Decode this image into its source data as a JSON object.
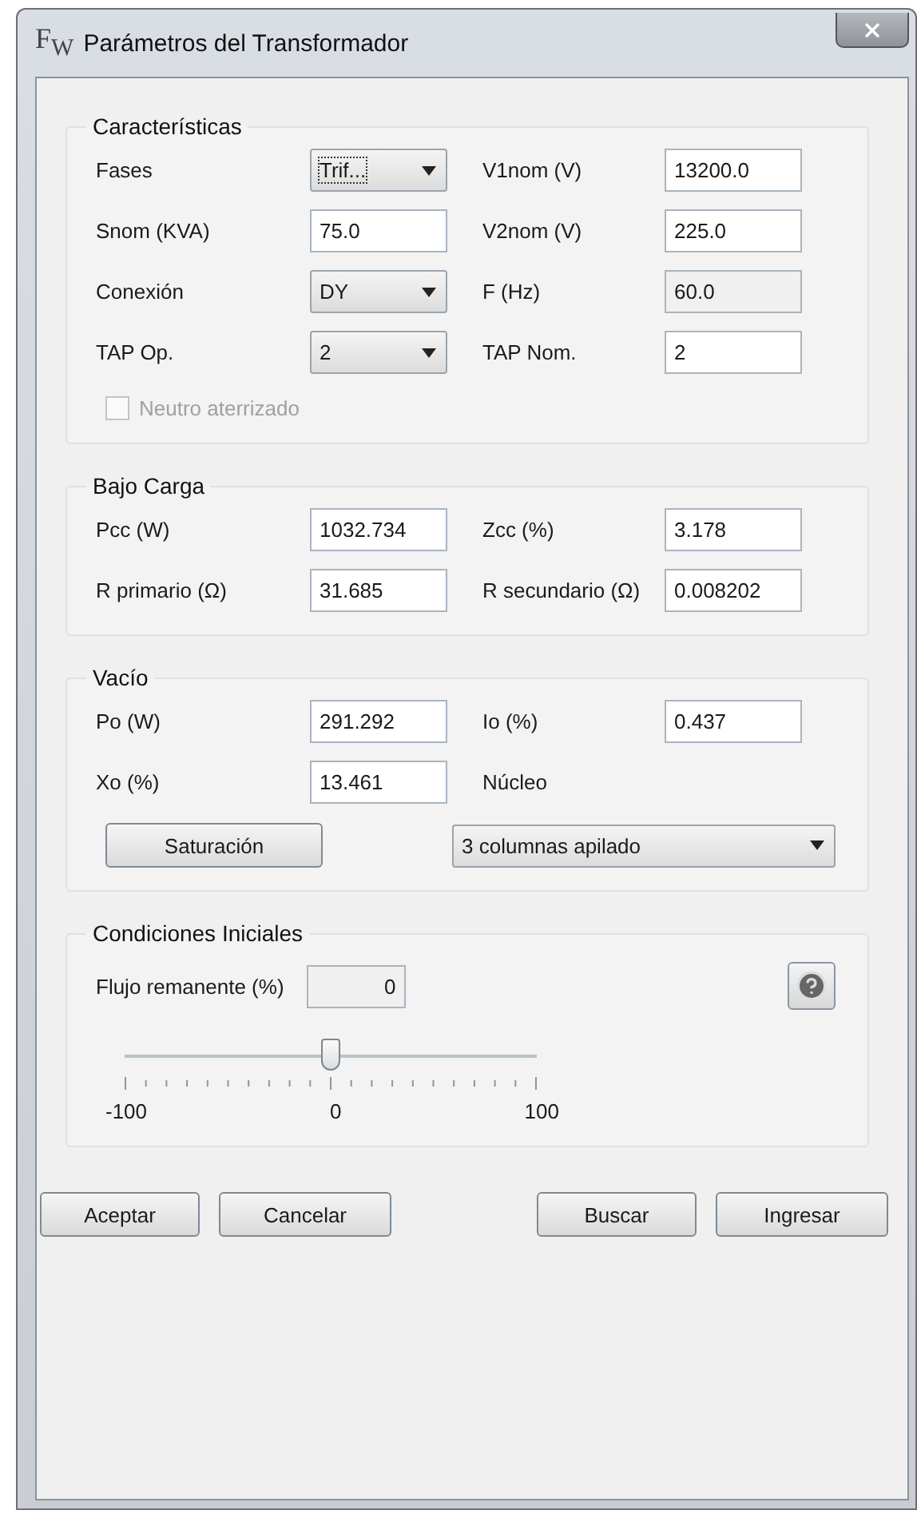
{
  "window": {
    "logo": "F$_{W}$",
    "title": "Parámetros del Transformador"
  },
  "sections": [
    {
      "title": "Características",
      "rows": [
        [
          {
            "label": "Fases",
            "kind": "dropdown",
            "value": "Trif...",
            "focused": true
          },
          {
            "label": "V1nom (V)",
            "kind": "input",
            "value": "13200.0"
          }
        ],
        [
          {
            "label": "Snom (KVA)",
            "kind": "input",
            "value": "75.0"
          },
          {
            "label": "V2nom (V)",
            "kind": "input",
            "value": "225.0"
          }
        ],
        [
          {
            "label": "Conexión",
            "kind": "dropdown",
            "value": "DY"
          },
          {
            "label": "F (Hz)",
            "kind": "readonly",
            "value": "60.0"
          }
        ],
        [
          {
            "label": "TAP Op.",
            "kind": "dropdown",
            "value": "2"
          },
          {
            "label": "TAP Nom.",
            "kind": "input",
            "value": "2"
          }
        ]
      ],
      "checkbox": {
        "label": "Neutro aterrizado",
        "checked": false,
        "disabled": true
      }
    },
    {
      "title": "Bajo Carga",
      "rows": [
        [
          {
            "label": "Pcc (W)",
            "kind": "input",
            "value": "1032.734"
          },
          {
            "label": "Zcc (%)",
            "kind": "input",
            "value": "3.178"
          }
        ],
        [
          {
            "label": "R primario (Ω)",
            "kind": "input",
            "value": "31.685"
          },
          {
            "label": "R secundario (Ω)",
            "kind": "input",
            "value": "0.008202"
          }
        ]
      ]
    },
    {
      "title": "Vacío",
      "rows": [
        [
          {
            "label": "Po (W)",
            "kind": "input",
            "value": "291.292"
          },
          {
            "label": "Io (%)",
            "kind": "input",
            "value": "0.437"
          }
        ],
        [
          {
            "label": "Xo (%)",
            "kind": "input",
            "value": "13.461"
          },
          {
            "label": "Núcleo",
            "kind": "none"
          }
        ]
      ],
      "actions": {
        "button": "Saturación",
        "dropdown": "3 columnas apilado"
      }
    }
  ],
  "initial": {
    "title": "Condiciones Iniciales",
    "label": "Flujo remanente (%)",
    "value": "0",
    "slider": {
      "level": 0.5,
      "labels": [
        "-100",
        "0",
        "100"
      ]
    }
  },
  "buttons": [
    "Aceptar",
    "Cancelar",
    "Buscar",
    "Ingresar"
  ]
}
